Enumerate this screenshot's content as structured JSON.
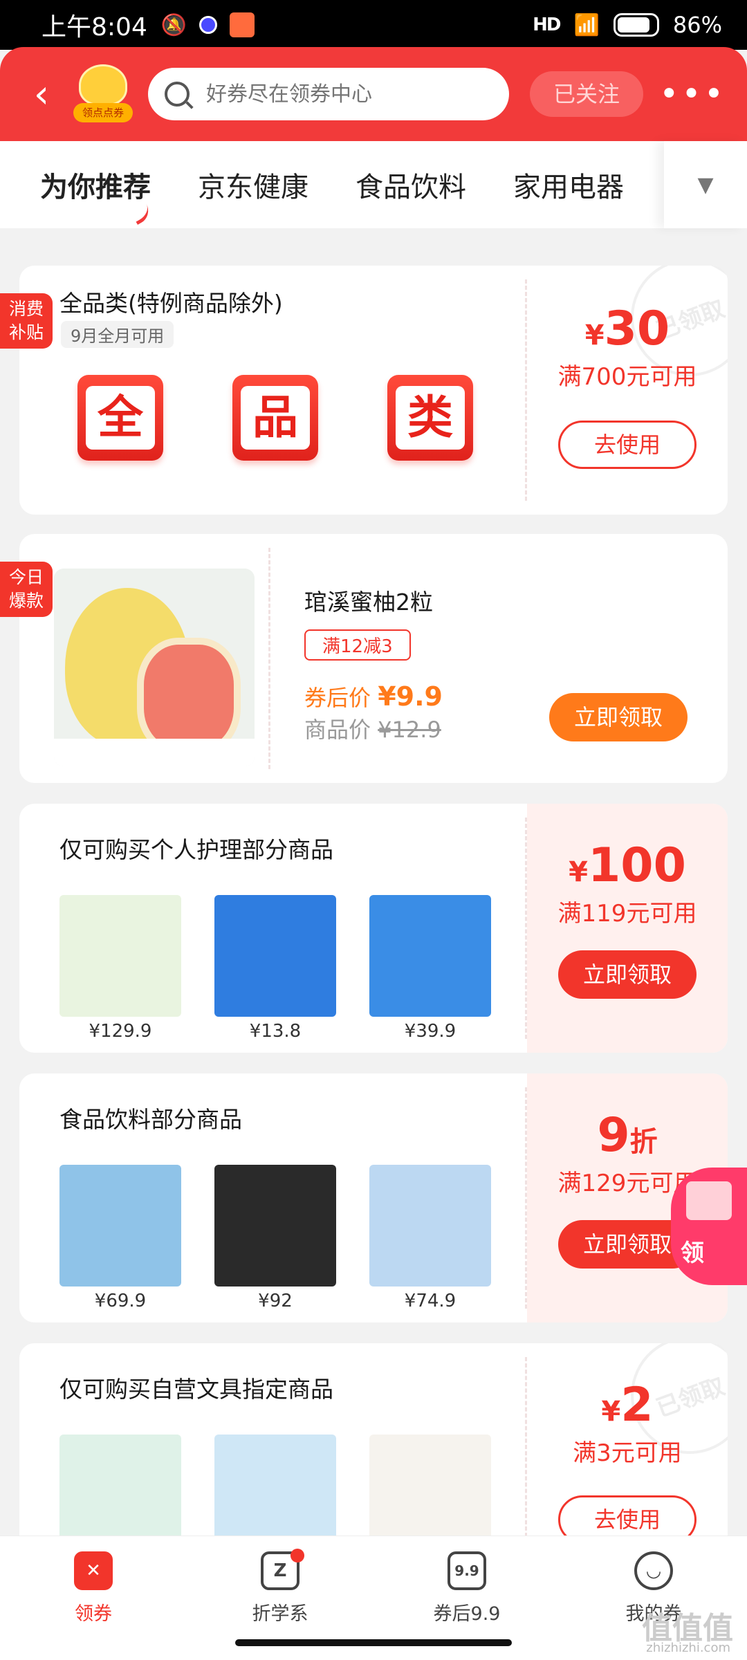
{
  "status_bar": {
    "time": "上午8:04",
    "signal": "HD",
    "battery": "86%"
  },
  "header": {
    "badge_label": "领点点券",
    "search_placeholder": "好券尽在领券中心",
    "follow_label": "已关注"
  },
  "tabs": [
    "为你推荐",
    "京东健康",
    "食品饮料",
    "家用电器"
  ],
  "coupons": [
    {
      "ribbon": "消费补贴",
      "title": "全品类(特例商品除外)",
      "validity": "9月全月可用",
      "tiles": [
        "全",
        "品",
        "类"
      ],
      "yen": "¥",
      "amount": "30",
      "condition": "满700元可用",
      "button": "去使用",
      "stamp": "已领取"
    },
    {
      "ribbon": "今日爆款",
      "title": "琯溪蜜柚2粒",
      "promo": "满12减3",
      "after_label": "券后价",
      "after_price": "¥9.9",
      "orig_label": "商品价",
      "orig_price": "¥12.9",
      "button": "立即领取"
    },
    {
      "title": "仅可购买个人护理部分商品",
      "yen": "¥",
      "amount": "100",
      "condition": "满119元可用",
      "button": "立即领取",
      "products": [
        {
          "price": "¥129.9",
          "color": "#e9f4e0"
        },
        {
          "price": "¥13.8",
          "color": "#2f7de0"
        },
        {
          "price": "¥39.9",
          "color": "#3a8de6"
        }
      ]
    },
    {
      "title": "食品饮料部分商品",
      "amount": "9",
      "unit": "折",
      "condition": "满129元可用",
      "button": "立即领取",
      "products": [
        {
          "price": "¥69.9",
          "color": "#8fc3e8"
        },
        {
          "price": "¥92",
          "color": "#2a2a2a"
        },
        {
          "price": "¥74.9",
          "color": "#bcd8f2"
        }
      ]
    },
    {
      "title": "仅可购买自营文具指定商品",
      "yen": "¥",
      "amount": "2",
      "condition": "满3元可用",
      "button": "去使用",
      "stamp": "已领取",
      "products": [
        {
          "color": "#dff2e8"
        },
        {
          "color": "#cfe7f6"
        },
        {
          "color": "#f6f3ee"
        }
      ]
    }
  ],
  "float_badge": "领",
  "bottom_nav": [
    {
      "label": "领券",
      "icon": "coupon-icon"
    },
    {
      "label": "折学系",
      "icon": "z-icon"
    },
    {
      "label": "券后9.9",
      "icon": "price-tag-icon",
      "icon_text": "9.9"
    },
    {
      "label": "我的券",
      "icon": "smile-icon"
    }
  ],
  "watermark": "值值值",
  "watermark_url": "zhizhizhi.com"
}
